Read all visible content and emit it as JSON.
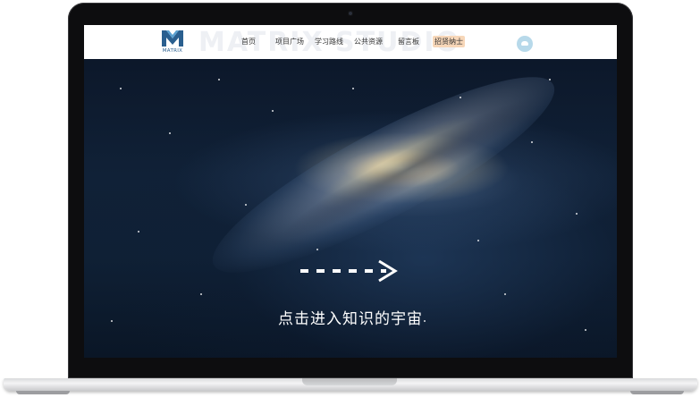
{
  "brand": {
    "logo_letter": "M",
    "logo_text": "MATRIX",
    "watermark": "MATRIX STUDIO",
    "accent": "#2a5f8f"
  },
  "nav": {
    "items": [
      {
        "label": "首页"
      },
      {
        "label": "项目广场"
      },
      {
        "label": "学习路线"
      },
      {
        "label": "公共资源"
      },
      {
        "label": "留言板"
      },
      {
        "label": "招贤纳士",
        "highlight_color": "#f7d7b9"
      }
    ],
    "icon": "cloud-icon"
  },
  "hero": {
    "arrow_icon": "dashed-arrow-right-icon",
    "cta_text": "点击进入知识的宇宙"
  }
}
